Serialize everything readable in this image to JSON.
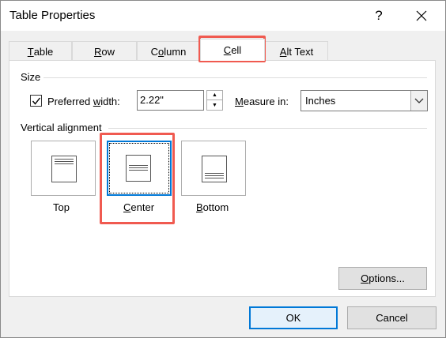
{
  "dialog": {
    "title": "Table Properties",
    "help_glyph": "?",
    "close_icon": "close-icon"
  },
  "tabs": [
    {
      "label": "Table",
      "accesskey_index": 0,
      "active": false
    },
    {
      "label": "Row",
      "accesskey_index": 0,
      "active": false
    },
    {
      "label": "Column",
      "accesskey_index": 1,
      "active": false
    },
    {
      "label": "Cell",
      "accesskey_index": 0,
      "active": true
    },
    {
      "label": "Alt Text",
      "accesskey_index": 0,
      "active": false
    }
  ],
  "size_group": {
    "label": "Size",
    "preferred_width_checked": true,
    "preferred_width_label_pre": "Preferred ",
    "preferred_width_label_key": "w",
    "preferred_width_label_post": "idth:",
    "width_value": "2.22\"",
    "measure_label_key": "M",
    "measure_label_post": "easure in:",
    "measure_value": "Inches"
  },
  "valign_group": {
    "label": "Vertical alignment",
    "options": [
      {
        "label_key": "T",
        "label_post": "op",
        "selected": false
      },
      {
        "label_key": "C",
        "label_post": "enter",
        "selected": true
      },
      {
        "label_key": "B",
        "label_post": "ottom",
        "selected": false
      }
    ]
  },
  "buttons": {
    "options_key": "O",
    "options_post": "ptions...",
    "ok": "OK",
    "cancel": "Cancel"
  },
  "colors": {
    "highlight": "#f05a50",
    "accent": "#0078d7"
  }
}
